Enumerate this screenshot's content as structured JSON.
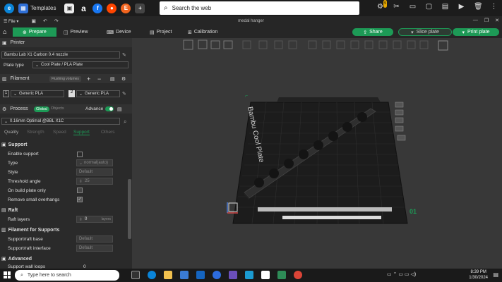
{
  "browser": {
    "tab_label": "Templates",
    "search_placeholder": "Search the web",
    "notification_count": "5"
  },
  "window": {
    "menu": "File",
    "title": "medal hanger"
  },
  "toolbar": {
    "prepare": "Prepare",
    "preview": "Preview",
    "device": "Device",
    "project": "Project",
    "calibration": "Calibration",
    "share": "Share",
    "slice_plate": "Slice plate",
    "print_plate": "Print plate"
  },
  "sidebar": {
    "printer_header": "Printer",
    "printer_name": "Bambu Lab X1 Carbon 0.4 nozzle",
    "plate_type_label": "Plate type",
    "plate_type_value": "Cool Plate / PLA Plate",
    "filament_header": "Filament",
    "flushing_volumes": "Flushing volumes",
    "filament_1_index": "1",
    "filament_1_name": "Generic PLA",
    "filament_2_index": "2",
    "filament_2_name": "Generic PLA",
    "process_header": "Process",
    "global_label": "Global",
    "objects_label": "Objects",
    "advance_label": "Advance",
    "process_preset": "0.16mm Optimal @BBL X1C",
    "tabs": [
      "Quality",
      "Strength",
      "Speed",
      "Support",
      "Others"
    ],
    "support_header": "Support",
    "enable_support": "Enable support",
    "type_label": "Type",
    "type_value": "normal(auto)",
    "style_label": "Style",
    "style_value": "Default",
    "threshold_label": "Threshold angle",
    "threshold_value": "25",
    "on_build_plate": "On build plate only",
    "remove_small": "Remove small overhangs",
    "raft_header": "Raft",
    "raft_layers_label": "Raft layers",
    "raft_layers_value": "0",
    "raft_layers_unit": "layers",
    "filament_supports_header": "Filament for Supports",
    "support_base_label": "Support/raft base",
    "support_base_value": "Default",
    "support_interface_label": "Support/raft interface",
    "support_interface_value": "Default",
    "advanced_header": "Advanced",
    "support_wall_loops": "Support wall loops",
    "support_wall_value": "0"
  },
  "viewport": {
    "plate_label": "Bambu Cool Plate",
    "plate_number": "01"
  },
  "taskbar": {
    "search_placeholder": "Type here to search",
    "time": "8:39 PM",
    "date": "1/30/2024"
  },
  "colors": {
    "accent": "#1d9a56",
    "sidebar_bg": "#2a2a2a",
    "viewport_bg": "#383838"
  }
}
